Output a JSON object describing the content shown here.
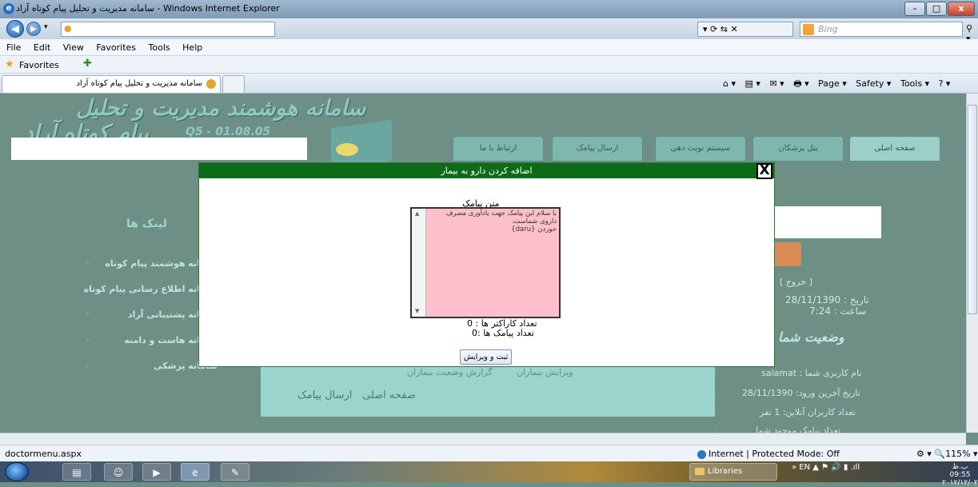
{
  "window": {
    "title": "سامانه مدیریت و تحلیل پیام کوتاه آراد - Windows Internet Explorer",
    "buttons": {
      "minimize": "–",
      "maximize": "□",
      "close": "x"
    }
  },
  "address_bar": {
    "url": "",
    "search_placeholder": "Bing",
    "back": "◀",
    "forward": "▶",
    "tools": "▾  ⟳  ⇆  ✕"
  },
  "menu": [
    "File",
    "Edit",
    "View",
    "Favorites",
    "Tools",
    "Help"
  ],
  "favorites_bar": {
    "label": "Favorites"
  },
  "tab": {
    "title": "سامانه مدیریت و تحلیل پیام کوتاه آراد"
  },
  "command_bar": [
    "⌂ ▾",
    "▤ ▾",
    "✉ ▾",
    "🖶 ▾",
    "Page ▾",
    "Safety ▾",
    "Tools ▾",
    "? ▾"
  ],
  "site": {
    "logo_line1": "سامانه هوشمند مدیریت و تحلیل",
    "logo_line2": "پیام کوتاه آراد",
    "version": "Q5 - 01.08.05",
    "nav_tabs": [
      "صفحه اصلی",
      "پنل پزشکان",
      "سیستم نوبت دهی",
      "ارسال پیامک",
      "ارتباط با ما"
    ],
    "links_header": "لینک ها",
    "links": [
      "سامانه هوشمند پیام کوتاه",
      "سامانه اطلاع رسانی پیام کوتاه",
      "سامانه پشتیبانی آراد",
      "سامانه هاست و دامنه",
      "سامانه پزشکی"
    ],
    "link_bullet": "◦",
    "exit_label": "[ خروج ]",
    "date_line": "تاریخ : 28/11/1390",
    "time_line": "ساعت : 7:24",
    "status_header": "وضعیت شما",
    "user_info": [
      "نام کاربری شما : salamat",
      "تاریخ آخرین ورود: 28/11/1390",
      "تعداد کاربران آنلاین: 1 نفر",
      "تعداد پیامک موجود شما"
    ],
    "bottom_links": {
      "edit_patients": "ویرایش بیماران",
      "patients_report": "گزارش وضعیت بیماران",
      "home": "صفحه اصلی",
      "send_sms": "ارسال پیامک"
    }
  },
  "modal": {
    "title": "اضافه کردن دارو به بیمار",
    "close": "X",
    "message_label": "متن پیامک",
    "message_text": "با سلام این پیامک جهت یادآوری مصرف داروی شماست.\nخوردن {daru}",
    "char_count": "تعداد کاراکتر ها : 0",
    "sms_count": "تعداد پیامک ها :0",
    "save_button": "ثبت و ویرایش"
  },
  "status_bar": {
    "url": "doctormenu.aspx",
    "zone": "Internet | Protected Mode: Off",
    "zoom": "⚙ ▾  🔍115%  ▾"
  },
  "taskbar": {
    "libraries": "Libraries",
    "tray": "»  EN  ▲  ⚑  🔊  ▮  .ıll",
    "clock_time": "ب.ظ 09:55",
    "clock_date": "۲۰۱۲/۱۲/۰۲"
  }
}
